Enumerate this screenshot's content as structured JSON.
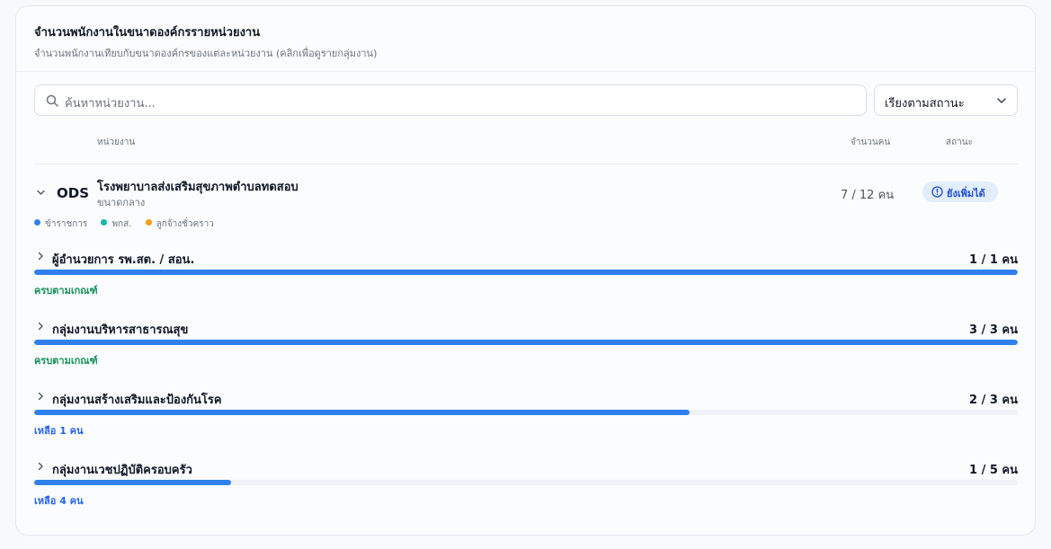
{
  "header": {
    "title": "จำนวนพนักงานในขนาดองค์กรรายหน่วยงาน",
    "subtitle": "จำนวนพนักงานเทียบกับขนาดองค์กรของแต่ละหน่วยงาน (คลิกเพื่อดูรายกลุ่มงาน)"
  },
  "search": {
    "placeholder": "ค้นหาหน่วยงาน..."
  },
  "sort": {
    "value": "เรียงตามสถานะ"
  },
  "table": {
    "col_unit": "หน่วยงาน",
    "col_count": "จำนวนคน",
    "col_status": "สถานะ"
  },
  "org": {
    "logo": "ODS",
    "name": "โรงพยาบาลส่งเสริมสุขภาพตำบลทดสอบ",
    "size": "ขนาดกลาง",
    "count": "7 / 12 คน",
    "status": "ยังเพิ่มได้"
  },
  "legend": [
    {
      "label": "ข้าราชการ",
      "color": "#2f80ed"
    },
    {
      "label": "พกส.",
      "color": "#14b8a6"
    },
    {
      "label": "ลูกจ้างชั่วคราว",
      "color": "#f59e0b"
    }
  ],
  "groups": [
    {
      "name": "ผู้อำนวยการ รพ.สต. / สอน.",
      "count": "1 / 1 คน",
      "filled": 1,
      "total": 1,
      "note": "ครบตามเกณฑ์"
    },
    {
      "name": "กลุ่มงานบริหารสาธารณสุข",
      "count": "3 / 3 คน",
      "filled": 3,
      "total": 3,
      "note": "ครบตามเกณฑ์"
    },
    {
      "name": "กลุ่มงานสร้างเสริมและป้องกันโรค",
      "count": "2 / 3 คน",
      "filled": 2,
      "total": 3,
      "note": "เหลือ 1 คน"
    },
    {
      "name": "กลุ่มงานเวชปฏิบัติครอบครัว",
      "count": "1 / 5 คน",
      "filled": 1,
      "total": 5,
      "note": "เหลือ 4 คน"
    }
  ],
  "colors": {
    "accent": "#2f80ed",
    "ok": "#15935a",
    "remain": "#2563eb"
  }
}
